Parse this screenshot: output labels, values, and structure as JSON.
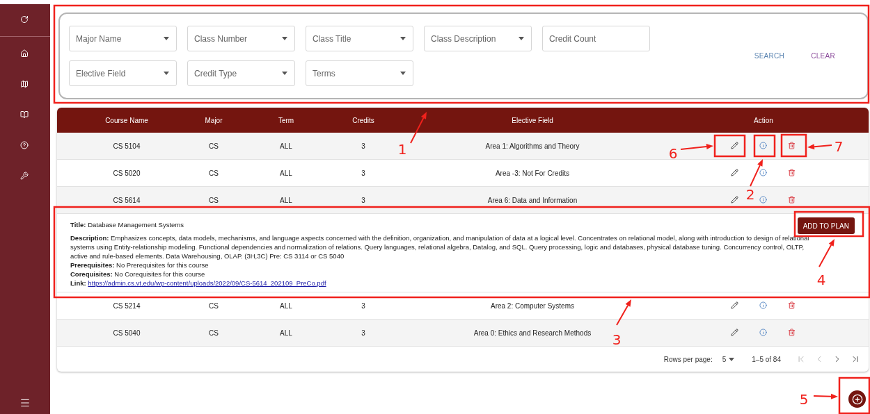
{
  "filters": {
    "fields": [
      {
        "kind": "select",
        "placeholder": "Major Name"
      },
      {
        "kind": "select",
        "placeholder": "Class Number"
      },
      {
        "kind": "select",
        "placeholder": "Class Title"
      },
      {
        "kind": "select",
        "placeholder": "Class Description"
      },
      {
        "kind": "text",
        "placeholder": "Credit Count"
      },
      {
        "kind": "select",
        "placeholder": "Elective Field"
      },
      {
        "kind": "select",
        "placeholder": "Credit Type"
      },
      {
        "kind": "select",
        "placeholder": "Terms"
      }
    ],
    "buttons": [
      {
        "label": "SEARCH",
        "kind": "search"
      },
      {
        "label": "CLEAR",
        "kind": "clear"
      }
    ]
  },
  "table": {
    "columns": [
      "Course Name",
      "Major",
      "Term",
      "Credits",
      "Elective Field",
      "Action"
    ],
    "rows": [
      {
        "cells": [
          "CS 5104",
          "CS",
          "ALL",
          "3",
          "Area 1: Algorithms and Theory"
        ]
      },
      {
        "cells": [
          "CS 5020",
          "CS",
          "ALL",
          "3",
          "Area -3: Not For Credits"
        ]
      },
      {
        "cells": [
          "CS 5614",
          "CS",
          "ALL",
          "3",
          "Area 6: Data and Information"
        ],
        "details": {
          "lines": [
            {
              "kind": "text",
              "text": "**Title:** Database Management Systems"
            },
            {
              "kind": "text",
              "text": "**Description:** Emphasizes concepts, data models, mechanisms, and language aspects concerned with the definition, organization, and manipulation of data at a logical level. Concentrates on relational model, along with introduction to design of relational systems using Entity-relationship modeling. Functional dependencies and normalization of relations. Query languages, relational algebra, Datalog, and SQL. Query processing, logic and databases, physical database tuning. Concurrency control, OLTP, active and rule-based elements. Data Warehousing, OLAP. (3H,3C) Pre: CS 3114 or CS 5040"
            },
            {
              "kind": "text",
              "text": "**Prerequisites:** No Prerequisites for this course"
            },
            {
              "kind": "text",
              "text": "**Corequisites:** No Corequisites for this course"
            },
            {
              "kind": "link",
              "label": "Link:",
              "url": "https://admin.cs.vt.edu/wp-content/uploads/2022/09/CS-5614_202109_PreCo.pdf"
            }
          ],
          "button": "ADD TO PLAN"
        }
      },
      {
        "cells": [
          "CS 5214",
          "CS",
          "ALL",
          "3",
          "Area 2: Computer Systems"
        ]
      },
      {
        "cells": [
          "CS 5040",
          "CS",
          "ALL",
          "3",
          "Area 0: Ethics and Research Methods"
        ]
      }
    ]
  },
  "pagination": {
    "rows_per_page_label": "Rows per page:",
    "rows_per_page": "5",
    "range": "1–5 of 84"
  },
  "annotations": [
    {
      "number": "1"
    },
    {
      "number": "2"
    },
    {
      "number": "3"
    },
    {
      "number": "4"
    },
    {
      "number": "5"
    },
    {
      "number": "6"
    },
    {
      "number": "7"
    }
  ]
}
